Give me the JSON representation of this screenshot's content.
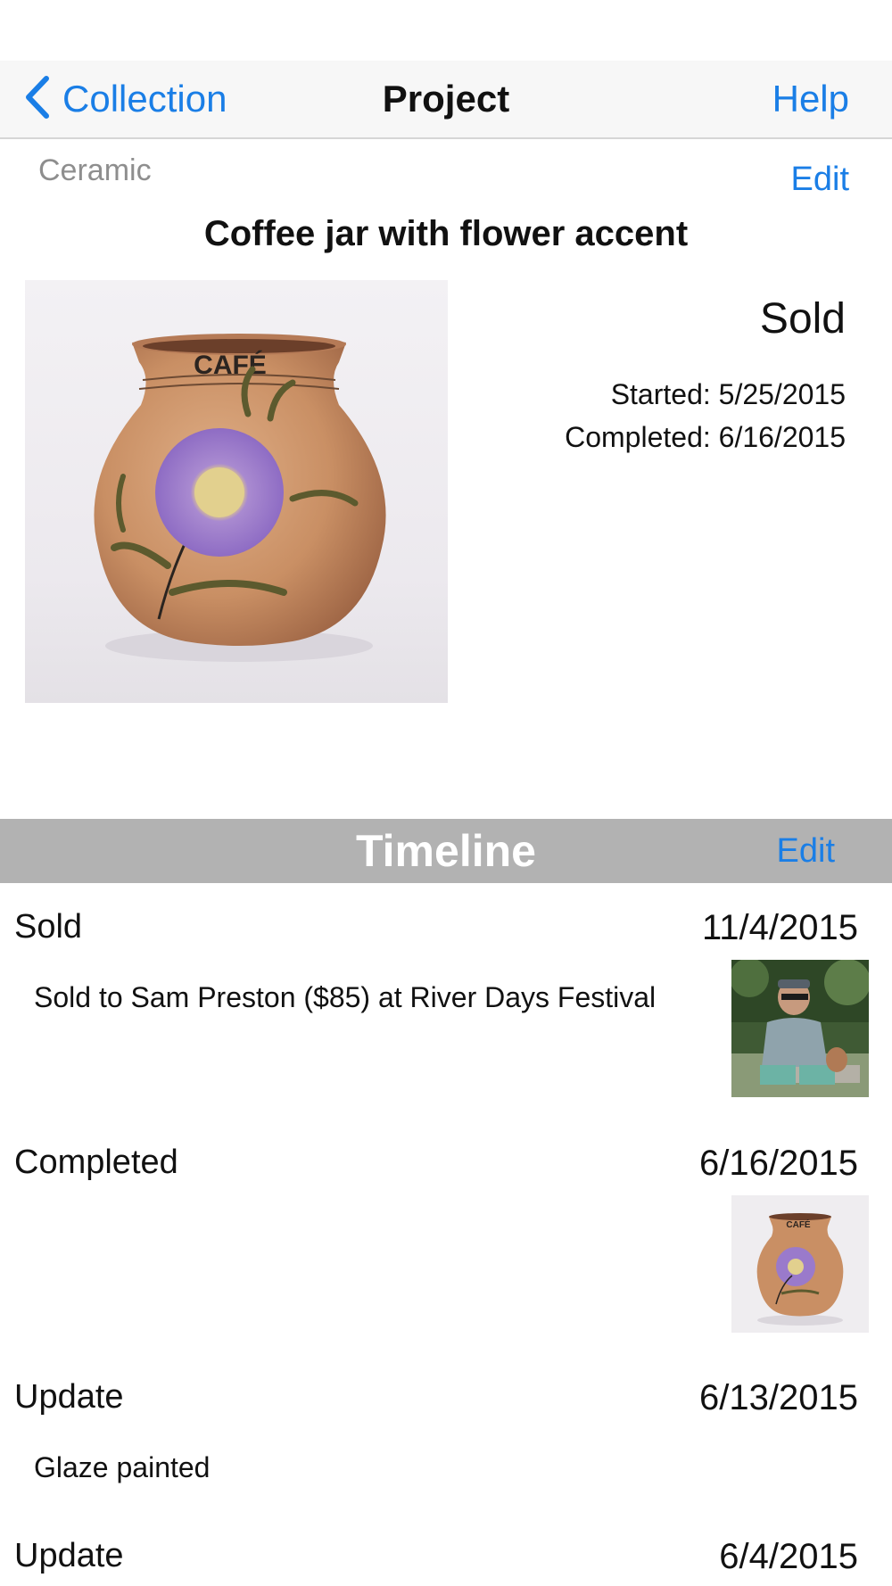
{
  "nav": {
    "back_label": "Collection",
    "title": "Project",
    "help_label": "Help"
  },
  "project": {
    "category": "Ceramic",
    "edit_label": "Edit",
    "title": "Coffee jar with flower accent",
    "status": "Sold",
    "started": "Started: 5/25/2015",
    "completed": "Completed: 6/16/2015",
    "photo_text": "CAFÉ"
  },
  "timeline": {
    "title": "Timeline",
    "edit_label": "Edit",
    "entries": [
      {
        "type": "Sold",
        "date": "11/4/2015",
        "note": "Sold to Sam Preston ($85) at River Days Festival",
        "thumb": "buyer-photo"
      },
      {
        "type": "Completed",
        "date": "6/16/2015",
        "note": "",
        "thumb": "jar-photo"
      },
      {
        "type": "Update",
        "date": "6/13/2015",
        "note": "Glaze painted",
        "thumb": ""
      },
      {
        "type": "Update",
        "date": "6/4/2015",
        "note": "",
        "thumb": ""
      }
    ]
  },
  "colors": {
    "accent": "#1a7ee6",
    "nav_background": "#f7f7f7",
    "timeline_header": "#b2b2b2",
    "secondary_text": "#8e8e8e"
  }
}
